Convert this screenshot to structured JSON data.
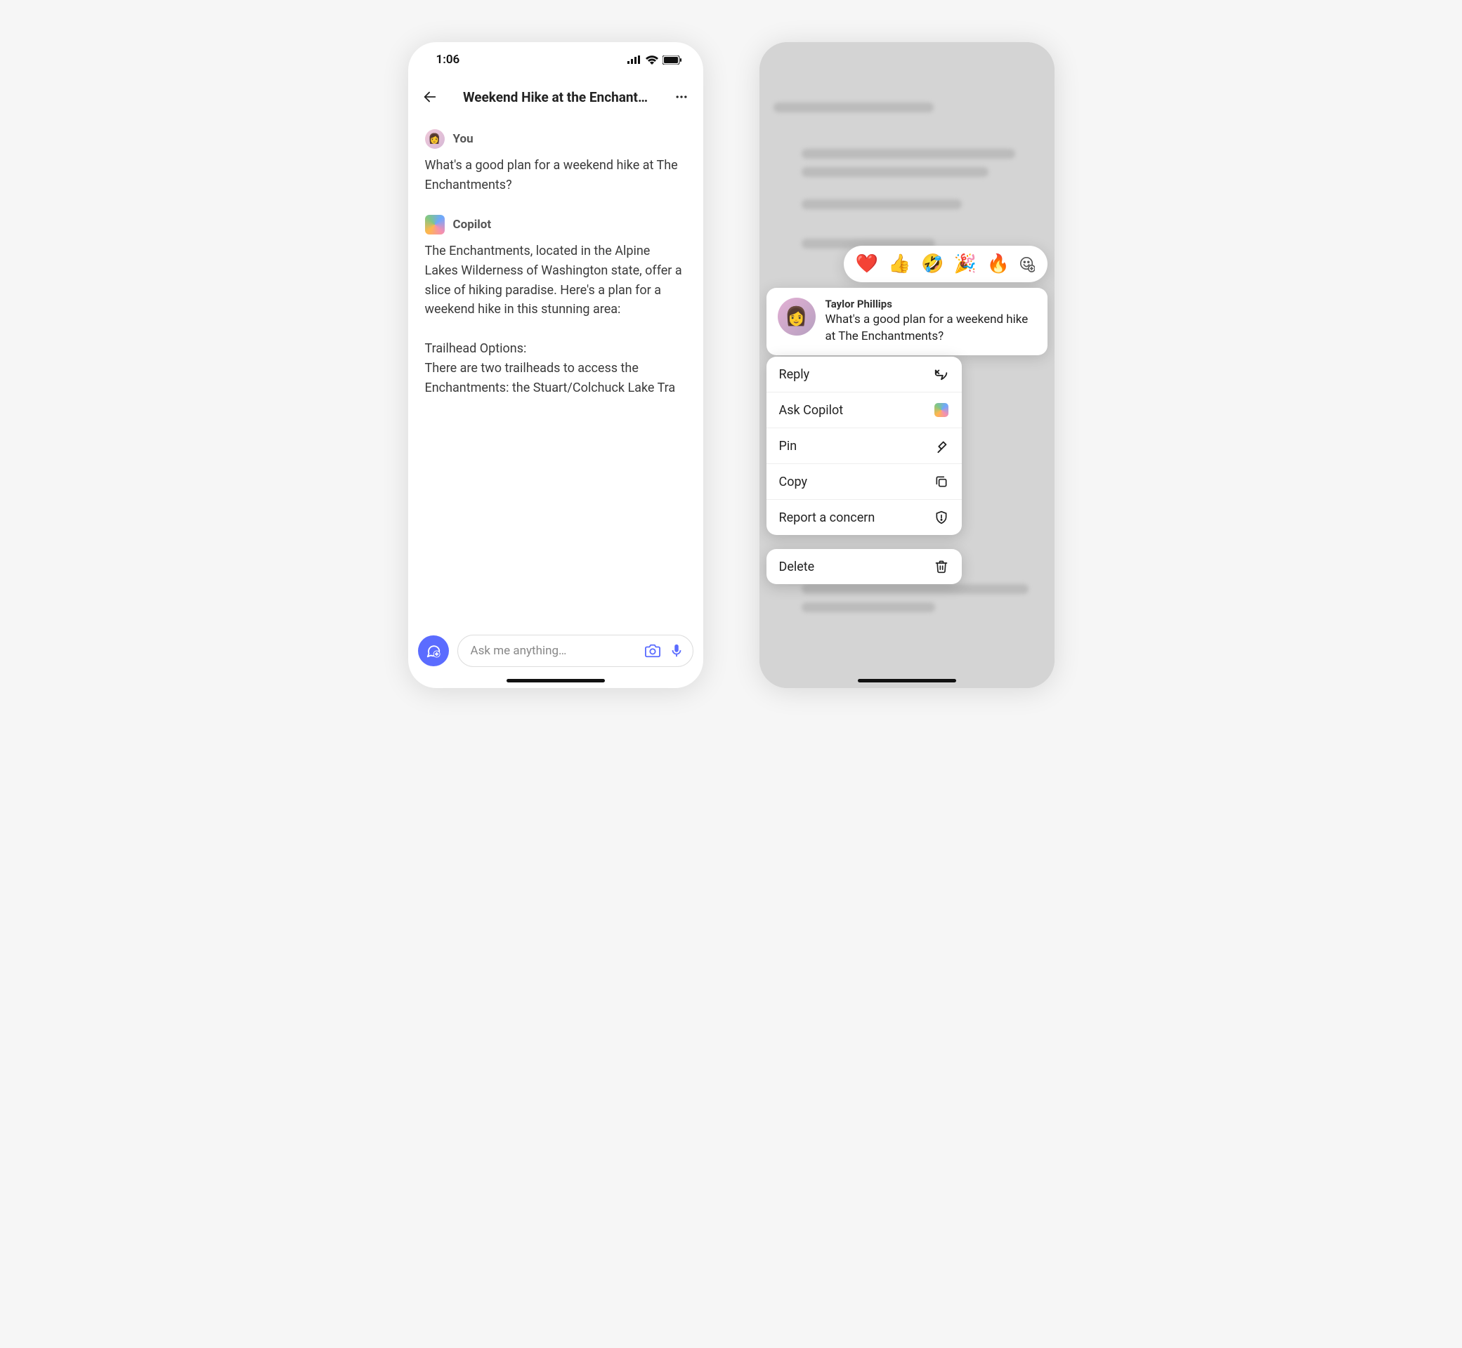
{
  "phone1": {
    "status_time": "1:06",
    "title": "Weekend Hike at the Enchant…",
    "you": {
      "sender": "You",
      "text": "What's a good plan for a weekend hike at The Enchantments?"
    },
    "copilot": {
      "sender": "Copilot",
      "text": "The Enchantments, located in the Alpine Lakes Wilderness of Washington state, offer a slice of hiking paradise. Here's a plan for a weekend hike in this stunning area:\n\nTrailhead Options:\nThere are two trailheads to access the Enchantments: the Stuart/Colchuck Lake Tra"
    },
    "input_placeholder": "Ask me anything…"
  },
  "phone2": {
    "reactions": [
      "❤️",
      "👍",
      "🤣",
      "🎉",
      "🔥"
    ],
    "focused": {
      "sender": "Taylor Phillips",
      "text": "What's a good plan for a weekend hike at The Enchantments?"
    },
    "menu": {
      "reply": "Reply",
      "ask_copilot": "Ask Copilot",
      "pin": "Pin",
      "copy": "Copy",
      "report": "Report a concern",
      "delete": "Delete"
    }
  }
}
